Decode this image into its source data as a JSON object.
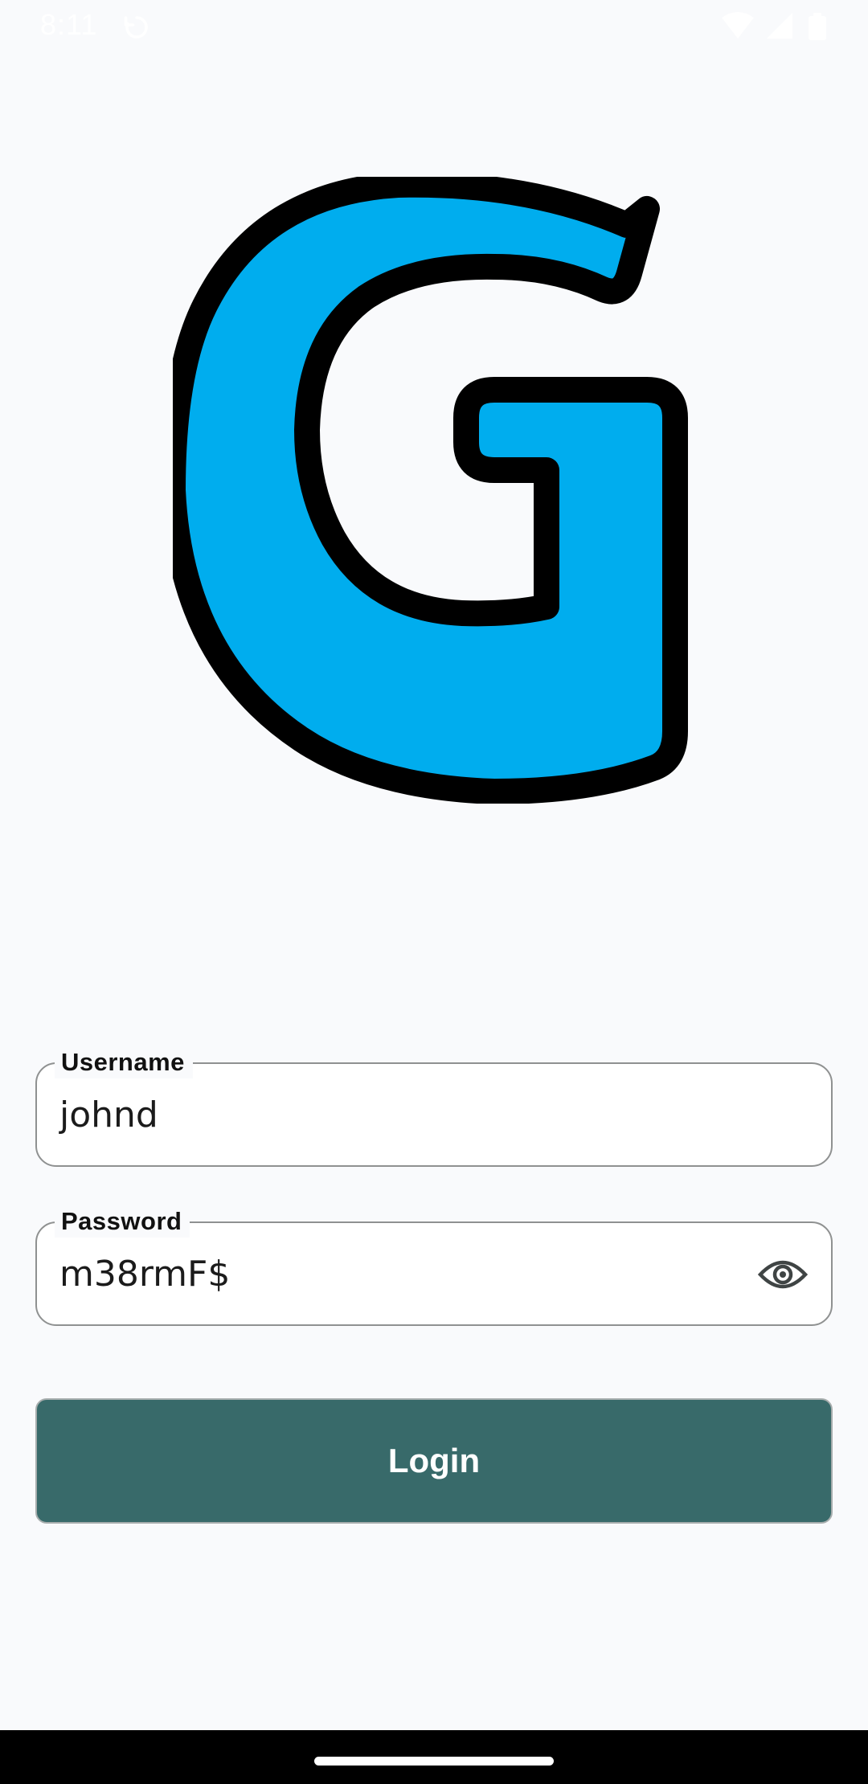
{
  "status_bar": {
    "time": "8:11",
    "icons": [
      "sync-icon",
      "wifi-icon",
      "cell-signal-icon",
      "battery-icon"
    ]
  },
  "logo": {
    "letter": "G",
    "fill_color": "#00adee",
    "outline_color": "#000000"
  },
  "form": {
    "username": {
      "label": "Username",
      "value": "johnd"
    },
    "password": {
      "label": "Password",
      "value": "m38rmF$",
      "toggle_icon": "eye-icon"
    },
    "login_label": "Login"
  },
  "colors": {
    "background": "#f9fafc",
    "button": "#386a6a",
    "field_border": "#8f9191"
  }
}
